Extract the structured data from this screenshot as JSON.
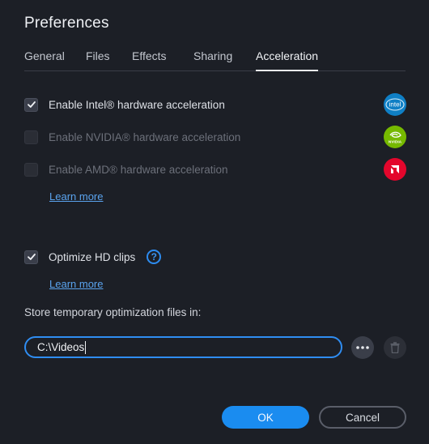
{
  "dialog": {
    "title": "Preferences"
  },
  "tabs": [
    {
      "label": "General",
      "active": false
    },
    {
      "label": "Files",
      "active": false
    },
    {
      "label": "Effects",
      "active": false
    },
    {
      "label": "Sharing",
      "active": false
    },
    {
      "label": "Acceleration",
      "active": true
    }
  ],
  "acceleration": {
    "options": [
      {
        "label": "Enable Intel® hardware acceleration",
        "checked": true,
        "enabled": true,
        "vendor_icon": "intel-logo-icon",
        "vendor_text": "intel",
        "color": "#0f7fc5"
      },
      {
        "label": "Enable NVIDIA® hardware acceleration",
        "checked": false,
        "enabled": false,
        "vendor_icon": "nvidia-logo-icon",
        "vendor_text": "NVIDIA",
        "color": "#76b900"
      },
      {
        "label": "Enable AMD® hardware acceleration",
        "checked": false,
        "enabled": false,
        "vendor_icon": "amd-logo-icon",
        "color": "#e3062c"
      }
    ],
    "learn_more_label": "Learn more"
  },
  "optimize": {
    "label": "Optimize HD clips",
    "checked": true,
    "help_icon": "question-circle-icon",
    "help_symbol": "?",
    "learn_more_label": "Learn more"
  },
  "storage": {
    "label": "Store temporary optimization files in:",
    "path": "C:\\Videos",
    "browse_icon": "more-dots-icon",
    "delete_icon": "trash-icon"
  },
  "buttons": {
    "ok_label": "OK",
    "cancel_label": "Cancel"
  },
  "colors": {
    "accent": "#2f8df2",
    "background": "#1c1f26"
  }
}
